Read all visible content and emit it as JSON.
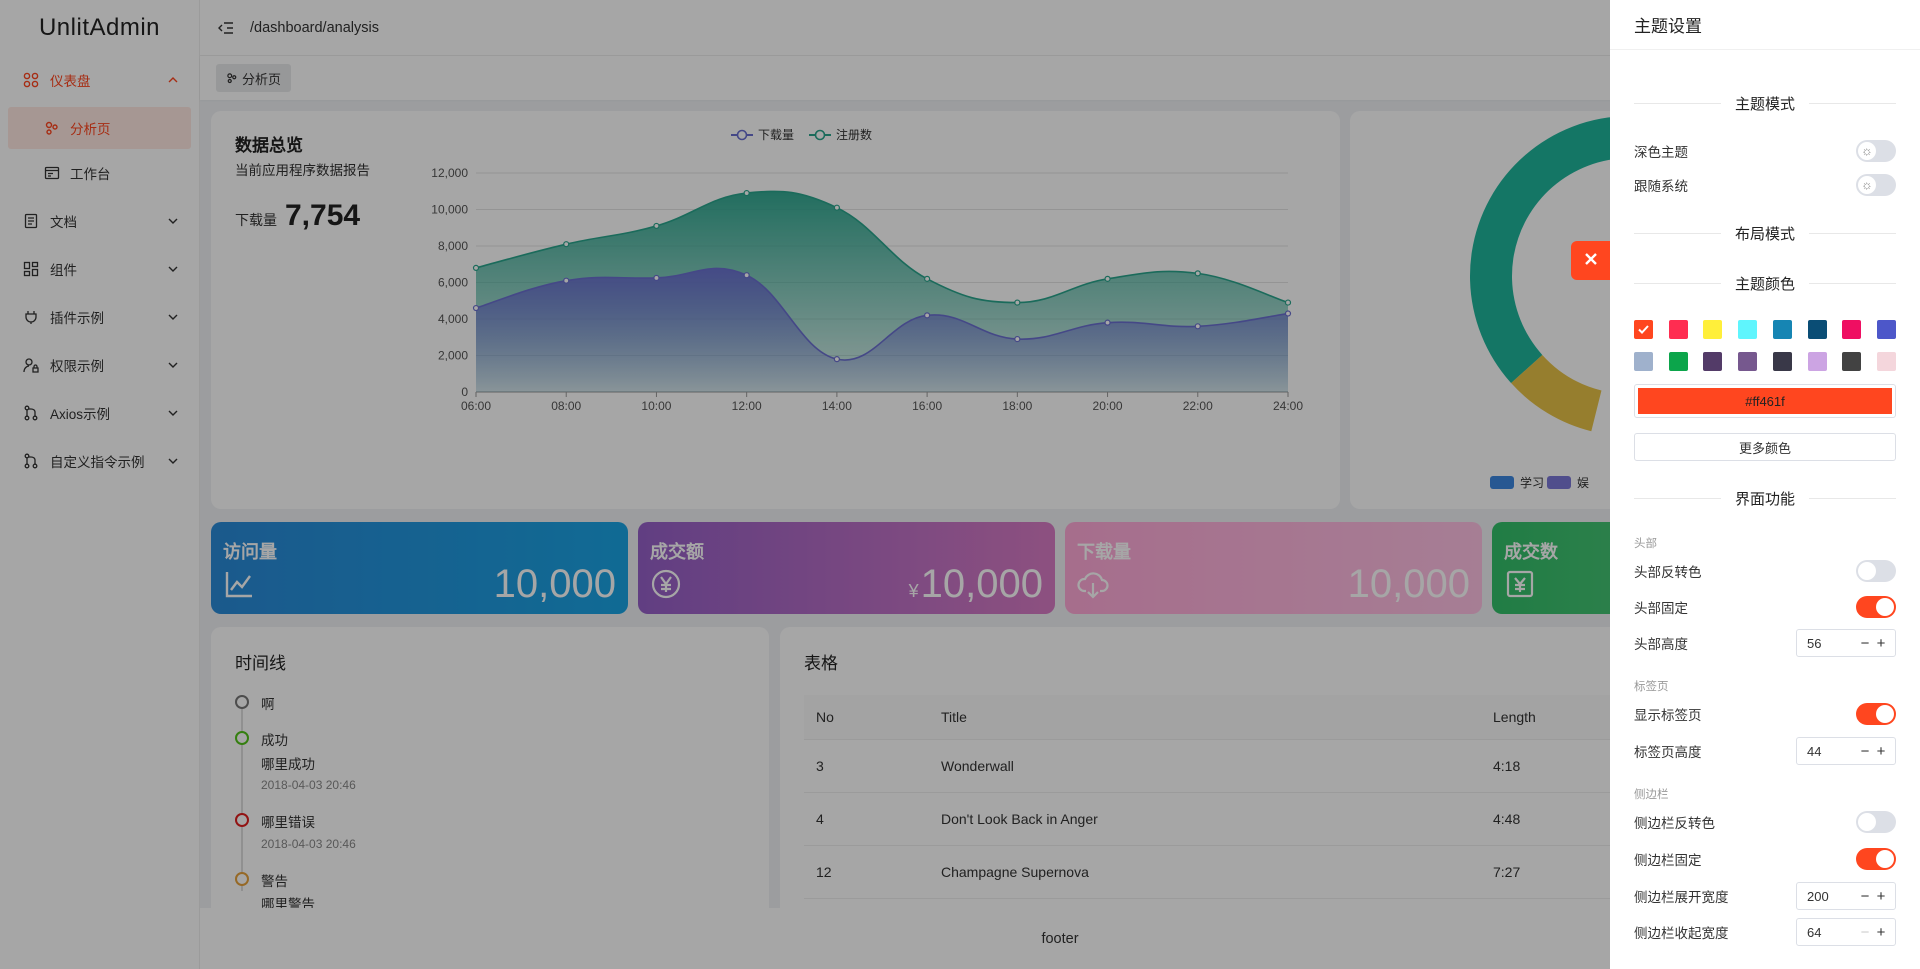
{
  "app": {
    "logo": "UnlitAdmin"
  },
  "sidebar": {
    "items": [
      {
        "label": "仪表盘",
        "icon": "dashboard-icon"
      },
      {
        "label": "分析页",
        "icon": "analysis-icon"
      },
      {
        "label": "工作台",
        "icon": "workbench-icon"
      },
      {
        "label": "文档",
        "icon": "document-icon"
      },
      {
        "label": "组件",
        "icon": "component-icon"
      },
      {
        "label": "插件示例",
        "icon": "plug-icon"
      },
      {
        "label": "权限示例",
        "icon": "user-lock-icon"
      },
      {
        "label": "Axios示例",
        "icon": "branch-icon"
      },
      {
        "label": "自定义指令示例",
        "icon": "branch-icon"
      }
    ]
  },
  "header": {
    "breadcrumb": "/dashboard/analysis"
  },
  "tabs": {
    "active_label": "分析页"
  },
  "overview": {
    "title": "数据总览",
    "subtitle": "当前应用程序数据报告",
    "download_label": "下载量",
    "download_value": "7,754"
  },
  "chart_data": {
    "type": "area",
    "x": [
      "06:00",
      "08:00",
      "10:00",
      "12:00",
      "14:00",
      "16:00",
      "18:00",
      "20:00",
      "22:00",
      "24:00"
    ],
    "series": [
      {
        "name": "下载量",
        "values": [
          4600,
          6100,
          6250,
          6400,
          1800,
          4200,
          2900,
          3800,
          3600,
          4300
        ],
        "color": "#6a6fd0"
      },
      {
        "name": "注册数",
        "values": [
          6800,
          8100,
          9100,
          10900,
          10100,
          6200,
          4900,
          6200,
          6500,
          4900
        ],
        "color": "#2aa58d"
      }
    ],
    "yticks": [
      "0",
      "2,000",
      "4,000",
      "6,000",
      "8,000",
      "10,000",
      "12,000"
    ],
    "ylim": [
      0,
      12000
    ],
    "legend": "top-center",
    "grid": true
  },
  "donut": {
    "legend": [
      "学习",
      "娱"
    ],
    "colors": {
      "teal": "#20b59b",
      "yellow": "#e6c247",
      "study": "#3d88e0",
      "fun": "#7c78d8"
    }
  },
  "stats": [
    {
      "title": "访问量",
      "value": "10,000",
      "currency": "",
      "icon": "chart-line-icon"
    },
    {
      "title": "成交额",
      "value": "10,000",
      "currency": "¥",
      "icon": "yen-icon"
    },
    {
      "title": "下载量",
      "value": "10,000",
      "currency": "",
      "icon": "cloud-download-icon"
    },
    {
      "title": "成交数",
      "value": "",
      "currency": "",
      "icon": "yen-receipt-icon"
    }
  ],
  "timeline": {
    "title": "时间线",
    "items": [
      {
        "text": "啊",
        "sub": "",
        "time": "",
        "color": "#777777"
      },
      {
        "text": "成功",
        "sub": "哪里成功",
        "time": "2018-04-03 20:46",
        "color": "#52c41a"
      },
      {
        "text": "哪里错误",
        "sub": "",
        "time": "2018-04-03 20:46",
        "color": "#e02020"
      },
      {
        "text": "警告",
        "sub": "哪里警告",
        "time": "",
        "color": "#e6a23c"
      }
    ]
  },
  "table": {
    "title": "表格",
    "columns": [
      "No",
      "Title",
      "Length"
    ],
    "rows": [
      {
        "no": "3",
        "title": "Wonderwall",
        "length": "4:18"
      },
      {
        "no": "4",
        "title": "Don't Look Back in Anger",
        "length": "4:48"
      },
      {
        "no": "12",
        "title": "Champagne Supernova",
        "length": "7:27"
      }
    ]
  },
  "footer": {
    "text": "footer"
  },
  "drawer": {
    "title": "主题设置",
    "section_theme": "主题模式",
    "dark_label": "深色主题",
    "follow_label": "跟随系统",
    "section_layout": "布局模式",
    "section_color": "主题颜色",
    "swatches_row1": [
      "#ff461f",
      "#ff2d51",
      "#ffef3a",
      "#5ff5fd",
      "#1685b3",
      "#0a4d75",
      "#ef0f62",
      "#4d57c9"
    ],
    "swatches_row2": [
      "#9fb1cc",
      "#0ca54b",
      "#533b68",
      "#76588e",
      "#393848",
      "#cca4e3",
      "#424242",
      "#f4d6dc"
    ],
    "current_color": "#ff461f",
    "more_colors": "更多颜色",
    "section_ui": "界面功能",
    "group_header": "头部",
    "header_invert": "头部反转色",
    "header_fixed": "头部固定",
    "header_height": "头部高度",
    "header_height_value": "56",
    "group_tabs": "标签页",
    "show_tabs": "显示标签页",
    "tabs_height": "标签页高度",
    "tabs_height_value": "44",
    "group_sidebar": "侧边栏",
    "sidebar_invert": "侧边栏反转色",
    "sidebar_fixed": "侧边栏固定",
    "sidebar_expand_width": "侧边栏展开宽度",
    "sidebar_expand_width_value": "200",
    "sidebar_collapse_width": "侧边栏收起宽度",
    "sidebar_collapse_width_value": "64"
  }
}
